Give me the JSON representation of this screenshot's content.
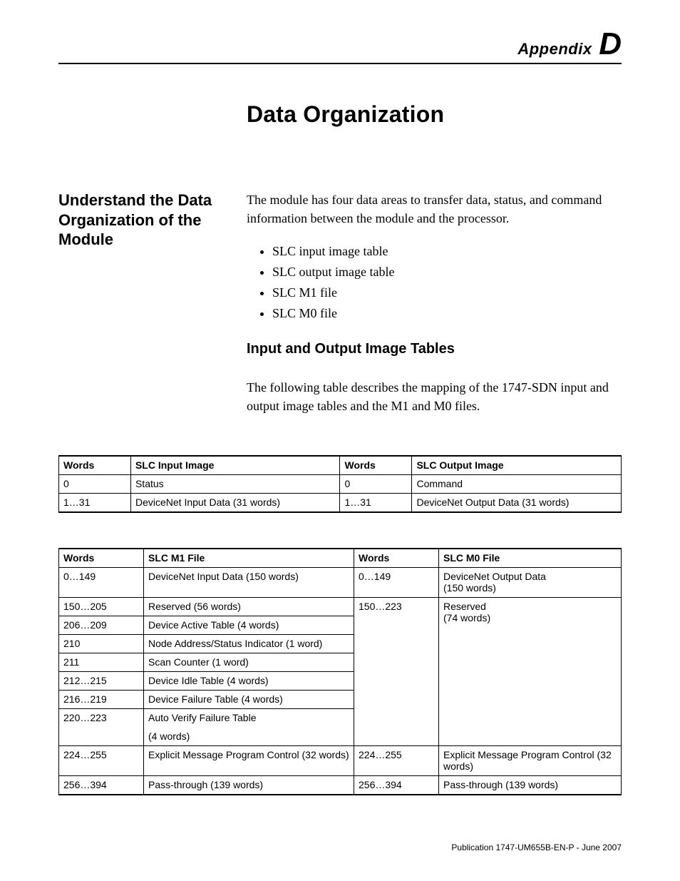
{
  "header": {
    "appendix_word": "Appendix",
    "appendix_letter": "D"
  },
  "chapter_title": "Data Organization",
  "section": {
    "heading": "Understand the Data Organization of the Module",
    "intro": "The module has four data areas to transfer data, status, and command information between the module and the processor.",
    "bullets": [
      "SLC input image table",
      "SLC output image table",
      "SLC M1 file",
      "SLC M0 file"
    ]
  },
  "subsection": {
    "heading": "Input and Output Image Tables",
    "body": "The following table describes the mapping of the 1747-SDN input and output image tables and the M1 and M0 files."
  },
  "table1": {
    "headers": [
      "Words",
      "SLC Input Image",
      "Words",
      "SLC Output Image"
    ],
    "rows": [
      [
        "0",
        "Status",
        "0",
        "Command"
      ],
      [
        "1…31",
        "DeviceNet Input Data (31 words)",
        "1…31",
        "DeviceNet Output Data (31 words)"
      ]
    ]
  },
  "table2": {
    "headers": [
      "Words",
      "SLC M1 File",
      "Words",
      "SLC M0 File"
    ],
    "left_rows": [
      {
        "w": "0…149",
        "d": "DeviceNet Input Data (150 words)"
      },
      {
        "w": "150…205",
        "d": "Reserved (56 words)"
      },
      {
        "w": "206…209",
        "d": "Device Active Table (4 words)"
      },
      {
        "w": "210",
        "d": "Node Address/Status Indicator (1 word)"
      },
      {
        "w": "211",
        "d": "Scan Counter (1 word)"
      },
      {
        "w": "212…215",
        "d": "Device Idle Table (4 words)"
      },
      {
        "w": "216…219",
        "d": "Device Failure Table (4 words)"
      },
      {
        "w": "220…223",
        "d": "Auto Verify Failure Table",
        "d2": "(4 words)"
      },
      {
        "w": "224…255",
        "d": "Explicit Message Program Control (32 words)"
      },
      {
        "w": "256…394",
        "d": "Pass-through (139 words)"
      }
    ],
    "right_rows": [
      {
        "w": "0…149",
        "d": "DeviceNet Output Data",
        "d2": "(150 words)"
      },
      {
        "w": "150…223",
        "d": "Reserved",
        "d2": "(74 words)",
        "rowspan": 7
      },
      {
        "w": "224…255",
        "d": "Explicit Message Program Control (32 words)"
      },
      {
        "w": "256…394",
        "d": "Pass-through (139 words)"
      }
    ]
  },
  "footer": "Publication 1747-UM655B-EN-P - June 2007"
}
